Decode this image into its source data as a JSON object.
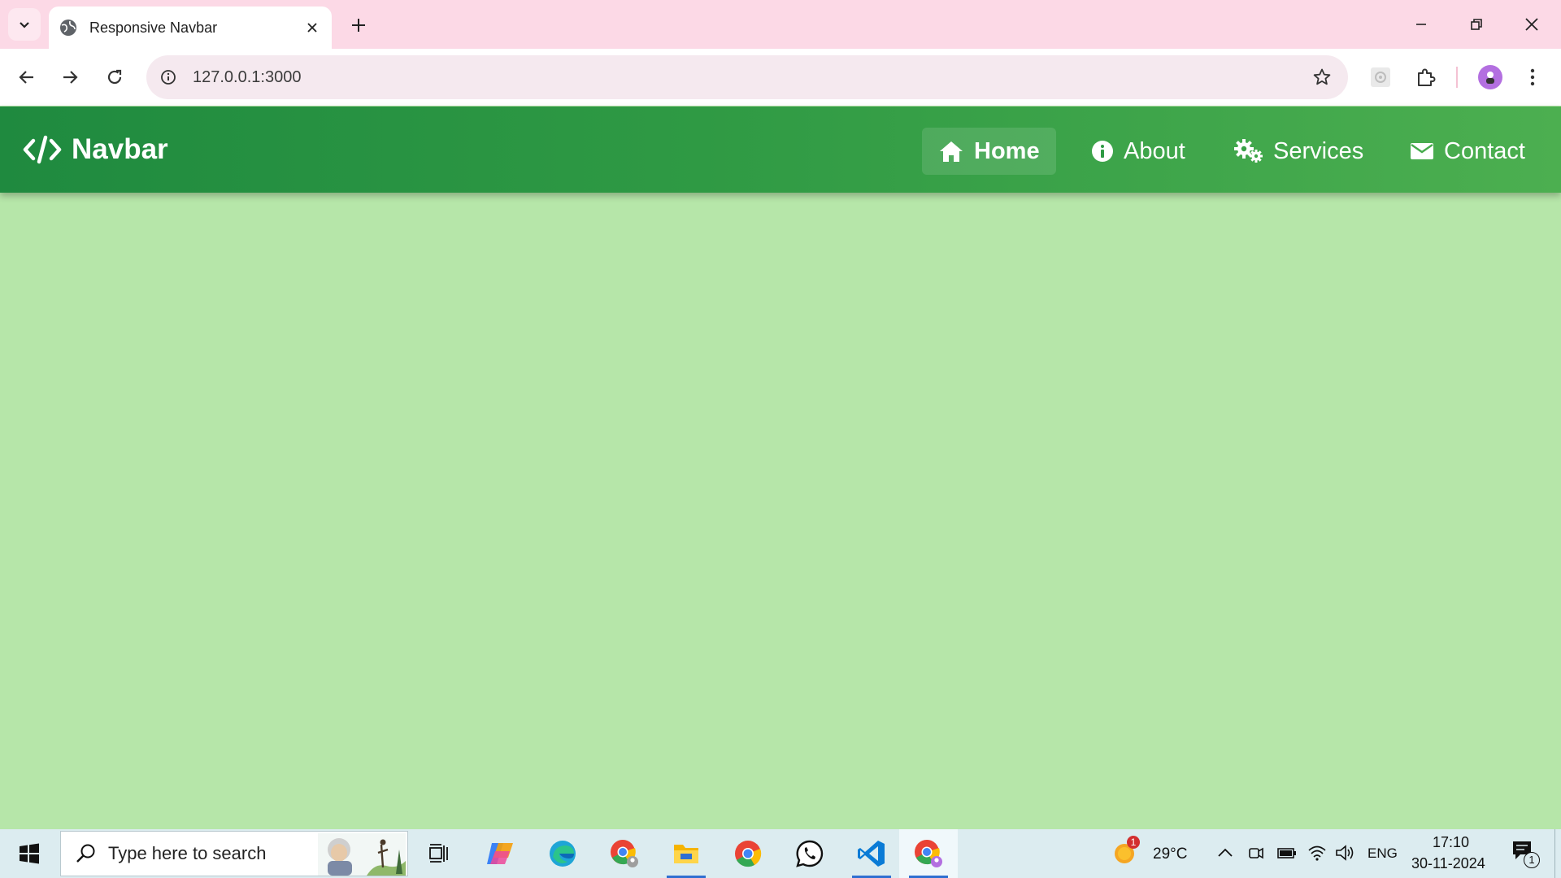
{
  "browser": {
    "tab_title": "Responsive Navbar",
    "url": "127.0.0.1:3000"
  },
  "navbar": {
    "brand": "Navbar",
    "items": [
      {
        "label": "Home",
        "icon": "home-icon",
        "active": true
      },
      {
        "label": "About",
        "icon": "info-circle-icon",
        "active": false
      },
      {
        "label": "Services",
        "icon": "cogs-icon",
        "active": false
      },
      {
        "label": "Contact",
        "icon": "envelope-icon",
        "active": false
      }
    ]
  },
  "taskbar": {
    "search_placeholder": "Type here to search",
    "weather_temp": "29°C",
    "weather_badge": "1",
    "language": "ENG",
    "time": "17:10",
    "date": "30-11-2024",
    "notification_count": "1"
  },
  "colors": {
    "page_background": "#b6e6a9",
    "navbar_start": "#1f8a3f",
    "navbar_end": "#4caf50",
    "tab_strip": "#fcd9e6"
  }
}
